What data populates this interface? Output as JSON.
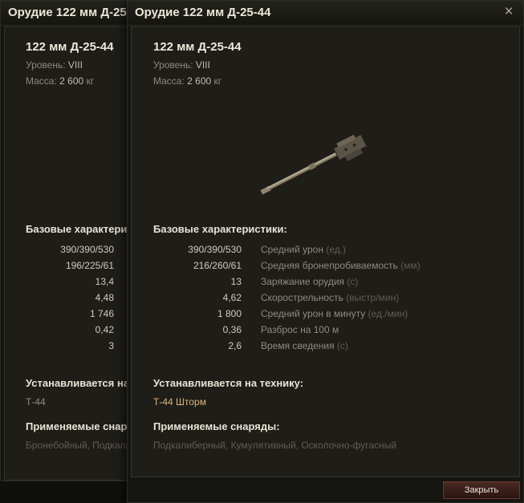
{
  "back_window": {
    "title": "Орудие 122 мм Д-25-",
    "gun_name": "122 мм Д-25-44",
    "level_label": "Уровень:",
    "level_value": "VIII",
    "mass_label": "Масса:",
    "mass_value": "2 600",
    "mass_unit": "кг",
    "stats_heading": "Базовые характеристи",
    "stats": [
      "390/390/530",
      "196/225/61",
      "13,4",
      "4,48",
      "1 746",
      "0,42",
      "3"
    ],
    "installed_heading": "Устанавливается на т",
    "vehicle": "Т-44",
    "shells_heading": "Применяемые снаряды",
    "shells": "Бронебойный, Подкали"
  },
  "front_window": {
    "title": "Орудие 122 мм Д-25-44",
    "gun_name": "122 мм Д-25-44",
    "level_label": "Уровень:",
    "level_value": "VIII",
    "mass_label": "Масса:",
    "mass_value": "2 600",
    "mass_unit": "кг",
    "stats_heading": "Базовые характеристики:",
    "stats": [
      {
        "value": "390/390/530",
        "label": "Средний урон",
        "unit": "(ед.)"
      },
      {
        "value": "216/260/61",
        "label": "Средняя бронепробиваемость",
        "unit": "(мм)"
      },
      {
        "value": "13",
        "label": "Заряжание орудия",
        "unit": "(с)"
      },
      {
        "value": "4,62",
        "label": "Скорострельность",
        "unit": "(выстр/мин)"
      },
      {
        "value": "1 800",
        "label": "Средний урон в минуту",
        "unit": "(ед./мин)"
      },
      {
        "value": "0,36",
        "label": "Разброс на 100 м",
        "unit": ""
      },
      {
        "value": "2,6",
        "label": "Время сведения",
        "unit": "(с)"
      }
    ],
    "installed_heading": "Устанавливается на технику:",
    "vehicle": "Т-44 Шторм",
    "shells_heading": "Применяемые снаряды:",
    "shells": "Подкалиберный, Кумулятивный, Осколочно-фугасный",
    "close_icon": "×",
    "close_button_label": "Закрыть",
    "vehicle_color": "#d9b47a"
  }
}
